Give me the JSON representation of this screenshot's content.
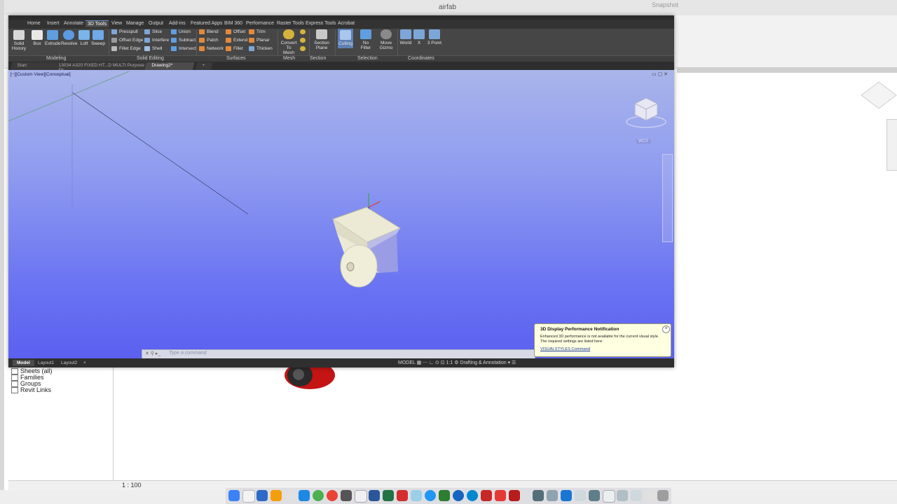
{
  "background_app": {
    "title": "airfab",
    "snapshot_label": "Snapshot",
    "scale": "1 : 100",
    "browser_tree": [
      "Sheets (all)",
      "Families",
      "Groups",
      "Revit Links"
    ]
  },
  "acad": {
    "ribbon_tabs": [
      "Home",
      "Insert",
      "Annotate",
      "3D Tools",
      "View",
      "Manage",
      "Output",
      "Add-ins",
      "Featured Apps",
      "BIM 360",
      "Performance",
      "Raster Tools",
      "Express Tools",
      "Acrobat"
    ],
    "active_ribbon_tab": "3D Tools",
    "modeling": {
      "label": "Modeling",
      "solid_history": "Solid History",
      "box": "Box",
      "extrude": "Extrude",
      "revolve": "Revolve",
      "loft": "Loft",
      "sweep": "Sweep"
    },
    "solid_editing": {
      "label": "Solid Editing",
      "presspull": "Presspull",
      "offset_edge": "Offset Edge",
      "fillet_edge": "Fillet Edge",
      "slice": "Slice",
      "interfere": "Interfere",
      "shell": "Shell",
      "union": "Union",
      "subtract": "Subtract",
      "intersect": "Intersect"
    },
    "surfaces": {
      "label": "Surfaces",
      "blend": "Blend",
      "patch": "Patch",
      "network": "Network",
      "offset": "Offset",
      "extend": "Extend",
      "fillet": "Fillet",
      "trim": "Trim",
      "planar": "Planar",
      "thicken": "Thicken"
    },
    "mesh": {
      "label": "Mesh",
      "convert": "Convert To Mesh"
    },
    "section": {
      "label": "Section",
      "section_plane": "Section Plane"
    },
    "selection": {
      "label": "Selection",
      "culling": "Culling",
      "no_filter": "No Filter",
      "move_gizmo": "Move Gizmo"
    },
    "coordinates": {
      "label": "Coordinates",
      "world": "World",
      "x": "X",
      "three_point": "3 Point"
    },
    "doc_tabs": [
      "Start",
      "13034 A320 FIXED HT...D MULTI Purpose D*",
      "Drawing2*"
    ],
    "active_doc_tab": "Drawing2*",
    "viewport_label": "[−][Custom View][Conceptual]",
    "wcs_label": "WCS",
    "command_placeholder": "Type a command",
    "layout_tabs": [
      "Model",
      "Layout1",
      "Layout2"
    ],
    "status_model": "MODEL",
    "workspace": "Drafting & Annotation",
    "annotation_scale": "1:1"
  },
  "notification": {
    "title": "3D Display Performance Notification",
    "body_line1": "Enhanced 3D performance is not available for the current visual style.",
    "body_line2": "The required settings are listed here:",
    "link": "VISUALSTYLES Command"
  },
  "colors": {
    "viewport_top": "#a9b5ea",
    "viewport_bottom": "#5b60f0",
    "ribbon": "#464646",
    "accent": "#6a8fc9"
  }
}
